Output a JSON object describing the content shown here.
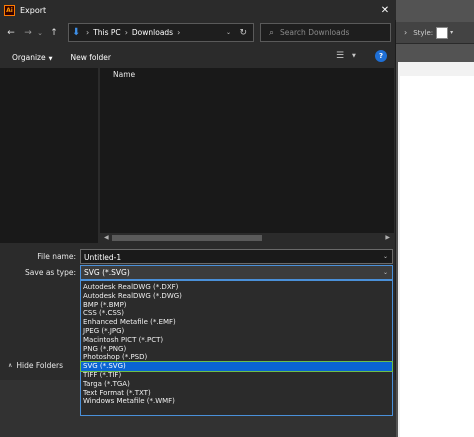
{
  "app": {
    "style_label": "Style:",
    "style_chevron": "›",
    "style_dropdown": "▾"
  },
  "dialog": {
    "title": "Export",
    "app_icon_text": "Ai",
    "close": "✕"
  },
  "navigation": {
    "back": "←",
    "forward": "→",
    "recent": "⌄",
    "up": "↑",
    "path": [
      "This PC",
      "Downloads"
    ],
    "separator": "›",
    "address_dropdown": "⌄",
    "refresh": "↻",
    "search_placeholder": "Search Downloads"
  },
  "commandbar": {
    "organize": "Organize",
    "organize_caret": "▼",
    "new_folder": "New folder",
    "view_icon": "☰",
    "view_dropdown": "▼",
    "help": "?"
  },
  "filelist": {
    "column_name": "Name",
    "scroll_left": "◀",
    "scroll_right": "▶"
  },
  "form": {
    "file_name_label": "File name:",
    "file_name_value": "Untitled-1",
    "save_as_type_label": "Save as type:",
    "save_as_type_value": "SVG (*.SVG)",
    "dropdown_arrow": "⌄"
  },
  "footer": {
    "hide_folders": "Hide Folders",
    "caret": "∧"
  },
  "file_types": [
    "Autodesk RealDWG (*.DXF)",
    "Autodesk RealDWG (*.DWG)",
    "BMP (*.BMP)",
    "CSS (*.CSS)",
    "Enhanced Metafile (*.EMF)",
    "JPEG (*.JPG)",
    "Macintosh PICT (*.PCT)",
    "PNG (*.PNG)",
    "Photoshop (*.PSD)",
    "SVG (*.SVG)",
    "TIFF (*.TIF)",
    "Targa (*.TGA)",
    "Text Format (*.TXT)",
    "Windows Metafile (*.WMF)"
  ],
  "selected_file_type": "SVG (*.SVG)",
  "colors": {
    "dialog_bg": "#2b2b2b",
    "pane_bg": "#191919",
    "accent_blue": "#0a64d2",
    "focus_border": "#4a90d9",
    "selection_outline": "#6cbf4a",
    "ai_orange": "#ff9a00"
  }
}
